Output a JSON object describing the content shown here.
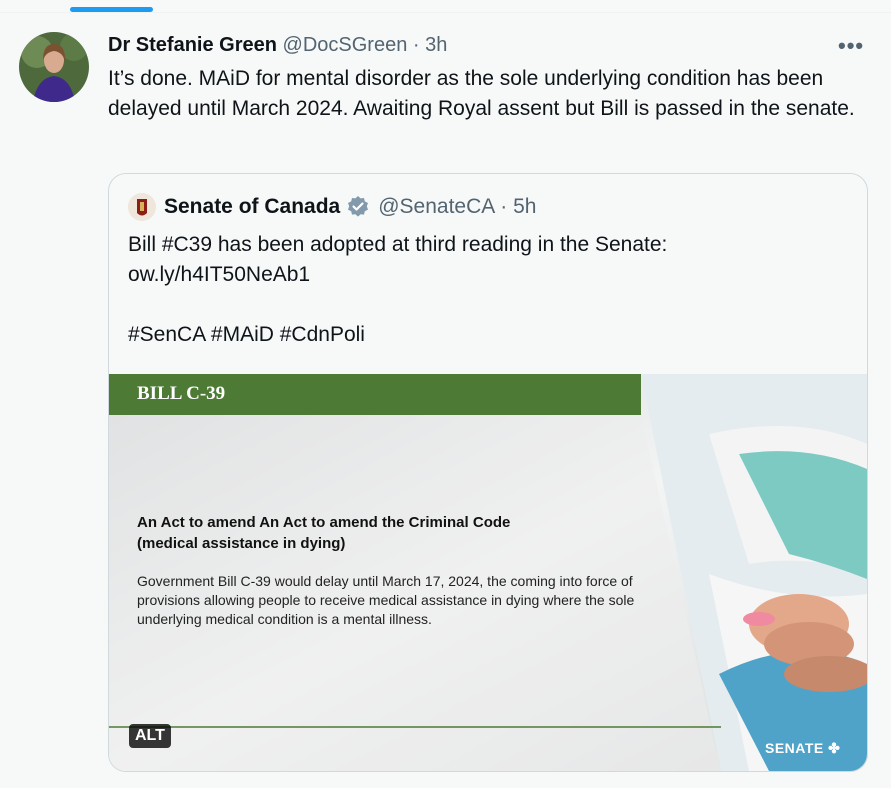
{
  "author": {
    "name": "Dr Stefanie Green",
    "handle": "@DocSGreen",
    "time": "· 3h"
  },
  "more_label": "•••",
  "tweet_text": "It’s done. MAiD for mental disorder as the sole underlying condition has been delayed until March 2024. Awaiting Royal assent but Bill is passed in the senate.",
  "quote": {
    "name": "Senate of Canada",
    "handle": "@SenateCA",
    "time": "· 5h",
    "text": "Bill #C39 has been adopted at third reading in the Senate:\now.ly/h4IT50NeAb1\n\n#SenCA #MAiD #CdnPoli",
    "image": {
      "bill_title": "BILL C-39",
      "act_title": "An Act to amend An Act to amend the Criminal Code (medical assistance in dying)",
      "act_description": "Government Bill C-39 would delay until March 17, 2024, the coming into force of provisions allowing people to receive medical assistance in dying where the sole underlying medical condition is a mental illness.",
      "alt_label": "ALT",
      "logo_text": "SENATE"
    }
  },
  "colors": {
    "accent": "#1d9bf0",
    "verified": "#829aab",
    "bill_green": "#4d7a34"
  }
}
